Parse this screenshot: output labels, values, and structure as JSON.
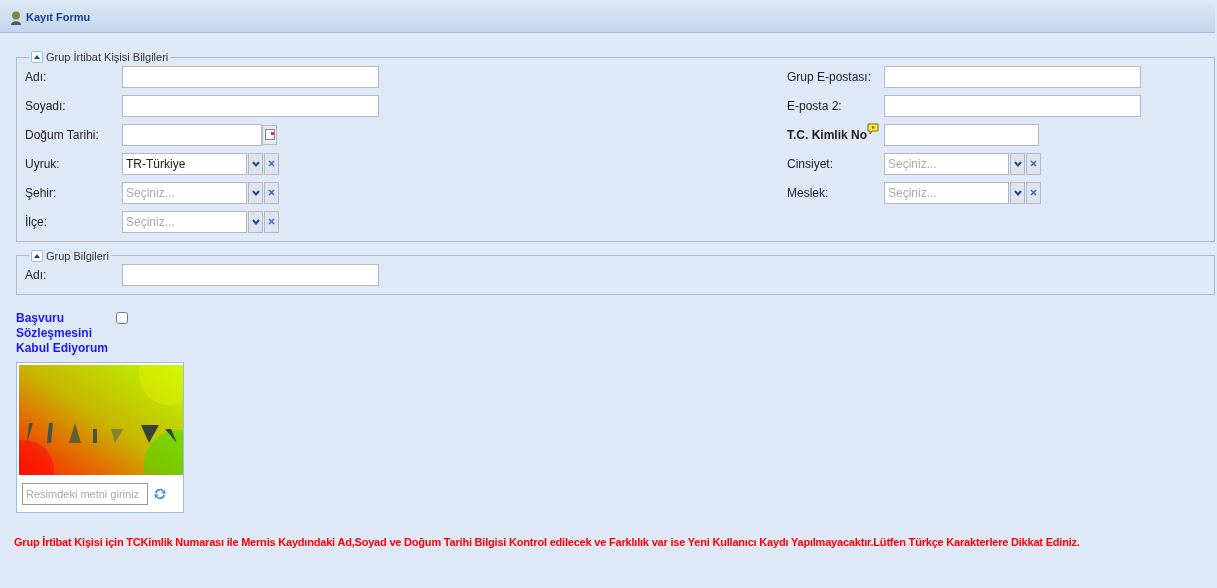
{
  "header": {
    "title": "Kayıt Formu"
  },
  "sections": [
    {
      "legend": "Grup İrtibat Kişisi Bilgileri",
      "expanded": true,
      "left_fields": [
        {
          "kind": "text",
          "label": "Adı:"
        },
        {
          "kind": "text",
          "label": "Soyadı:"
        },
        {
          "kind": "date",
          "label": "Doğum Tarihi:"
        },
        {
          "kind": "combo",
          "label": "Uyruk:",
          "value": "TR-Türkiye"
        },
        {
          "kind": "combo",
          "label": "Şehir:",
          "placeholder": "Seçiniz..."
        },
        {
          "kind": "combo",
          "label": "İlçe:",
          "placeholder": "Seçiniz..."
        }
      ],
      "right_fields": [
        {
          "kind": "text",
          "label": "Grup E-postası:"
        },
        {
          "kind": "text",
          "label": "E-posta 2:"
        },
        {
          "kind": "help_text",
          "label": "T.C. Kimlik No"
        },
        {
          "kind": "combo",
          "label": "Cinsiyet:",
          "placeholder": "Seçiniz..."
        },
        {
          "kind": "combo",
          "label": "Meslek:",
          "placeholder": "Seçiniz..."
        }
      ]
    },
    {
      "legend": "Grup Bilgileri",
      "expanded": true,
      "left_fields": [
        {
          "kind": "text",
          "label": "Adı:"
        }
      ]
    }
  ],
  "agreement": {
    "label": "Başvuru Sözleşmesini Kabul Ediyorum",
    "checked": false
  },
  "captcha": {
    "placeholder": "Resimdeki metni giriniz"
  },
  "notice": "Grup İrtibat Kişisi için TCKimlik Numarası ile Mernis Kaydındaki Ad,Soyad ve Doğum Tarihi Bilgisi Kontrol edilecek ve Farklılık var ise Yeni Kullanıcı Kaydı Yapılmayacaktır.Lütfen Türkçe Karakterlere Dikkat Ediniz."
}
